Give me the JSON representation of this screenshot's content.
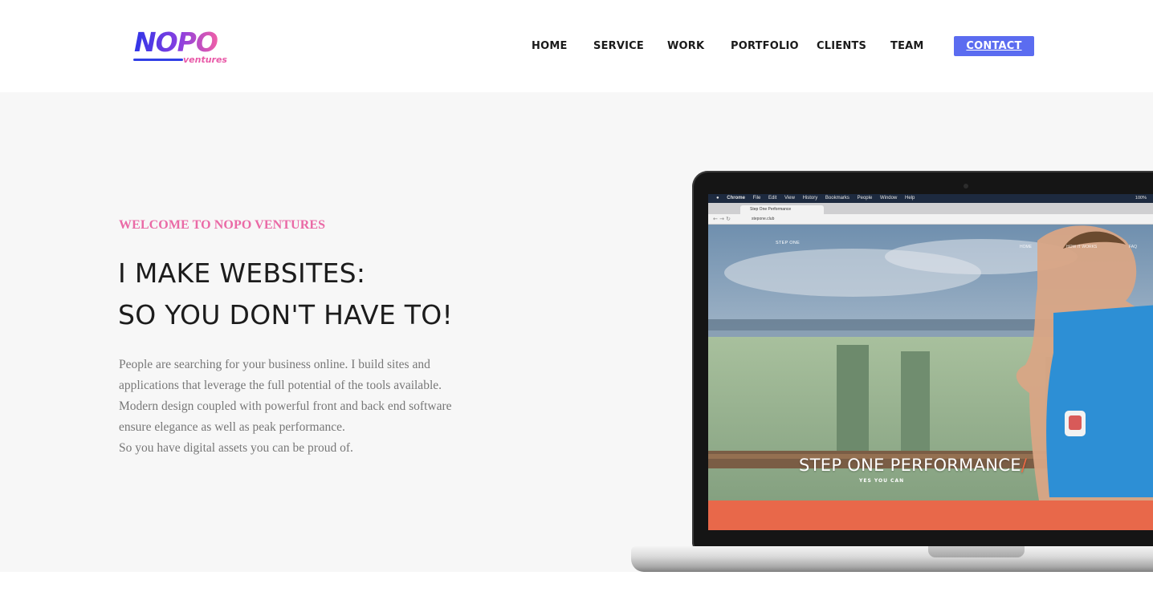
{
  "brand": {
    "logo_main": "NOPO",
    "logo_sub": "ventures",
    "colors": {
      "gradient_start": "#2f35e8",
      "gradient_end": "#ef5fa7"
    }
  },
  "nav": {
    "items": [
      {
        "label": "HOME"
      },
      {
        "label": "SERVICE"
      },
      {
        "label": "WORK"
      },
      {
        "label": "PORTFOLIO"
      },
      {
        "label": "CLIENTS"
      },
      {
        "label": "TEAM"
      }
    ],
    "contact_label": "CONTACT",
    "contact_color": "#5b6cf0"
  },
  "hero": {
    "eyebrow": "WELCOME TO NOPO VENTURES",
    "eyebrow_color": "#ea6aa6",
    "headline_line1": "I MAKE WEBSITES:",
    "headline_line2": "SO YOU DON'T HAVE TO!",
    "body_lines": [
      "People are searching for your business online. I build sites and",
      "applications that leverage the full potential of the tools available.",
      "Modern design coupled with powerful front and back end software",
      "ensure elegance as well as peak performance.",
      "So you have digital assets you can be proud of."
    ]
  },
  "mockup": {
    "menubar": {
      "app": "Chrome",
      "menus": [
        "File",
        "Edit",
        "View",
        "History",
        "Bookmarks",
        "People",
        "Window",
        "Help"
      ],
      "status": "100%"
    },
    "browser": {
      "tab_title": "Step One Performance",
      "url": "stepone.club"
    },
    "site": {
      "logo_text": "STEP ONE",
      "title_main": "STEP ONE PERFORMANCE",
      "title_slash": "/",
      "subtitle": "YES YOU CAN",
      "nav_a": "HOME",
      "nav_b": "HOW IT WORKS",
      "nav_c": "FAQ"
    }
  }
}
